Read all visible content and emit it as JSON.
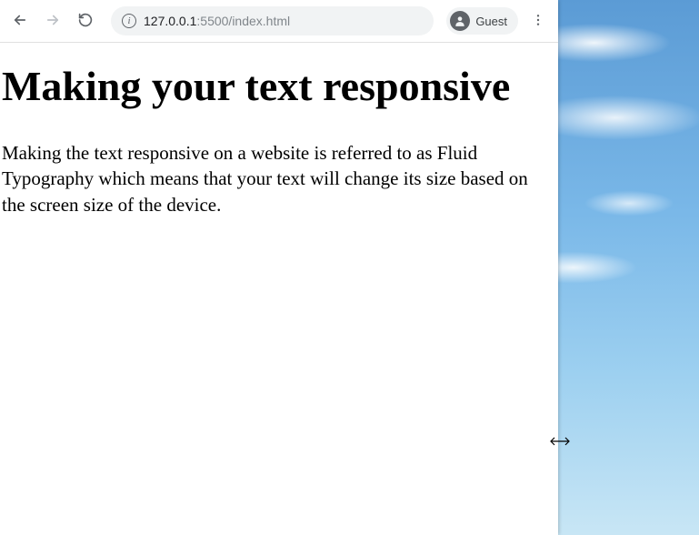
{
  "toolbar": {
    "url_host": "127.0.0.1",
    "url_port_path": ":5500/index.html",
    "guest_label": "Guest"
  },
  "page": {
    "heading": "Making your text responsive",
    "paragraph": "Making the text responsive on a website is referred to as Fluid Typography which means that your text will change its size based on the screen size of the device."
  }
}
